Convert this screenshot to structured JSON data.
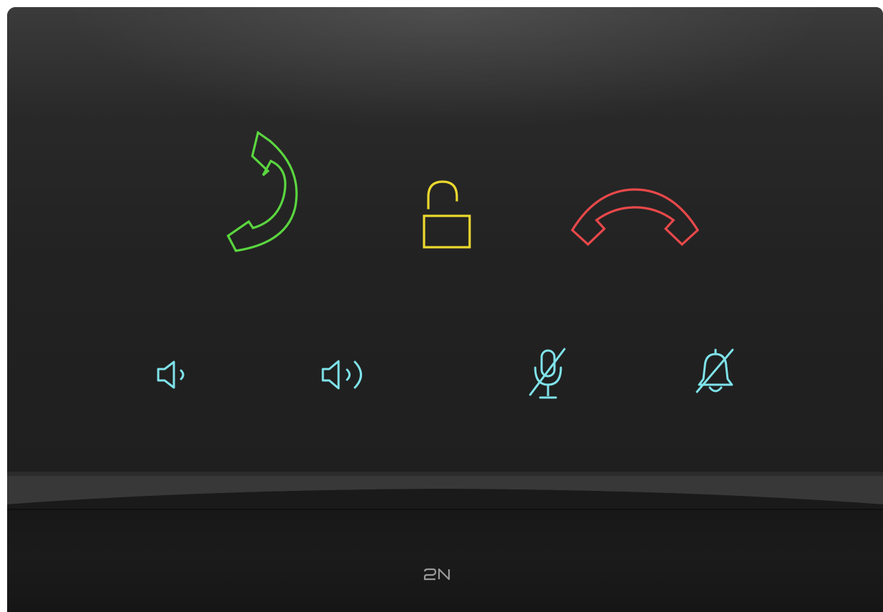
{
  "device": {
    "brand_logo": "2N"
  },
  "buttons": {
    "answer": {
      "icon": "phone-answer-icon",
      "color": "#5ad63f"
    },
    "unlock": {
      "icon": "unlocked-padlock-icon",
      "color": "#ecd92e"
    },
    "hangup": {
      "icon": "phone-hangup-icon",
      "color": "#e8484a"
    },
    "volume_down": {
      "icon": "speaker-low-icon",
      "color": "#7fe3ea"
    },
    "volume_up": {
      "icon": "speaker-high-icon",
      "color": "#7fe3ea"
    },
    "mic_mute": {
      "icon": "microphone-muted-icon",
      "color": "#7fe3ea"
    },
    "ringer_mute": {
      "icon": "bell-muted-icon",
      "color": "#7fe3ea"
    }
  }
}
